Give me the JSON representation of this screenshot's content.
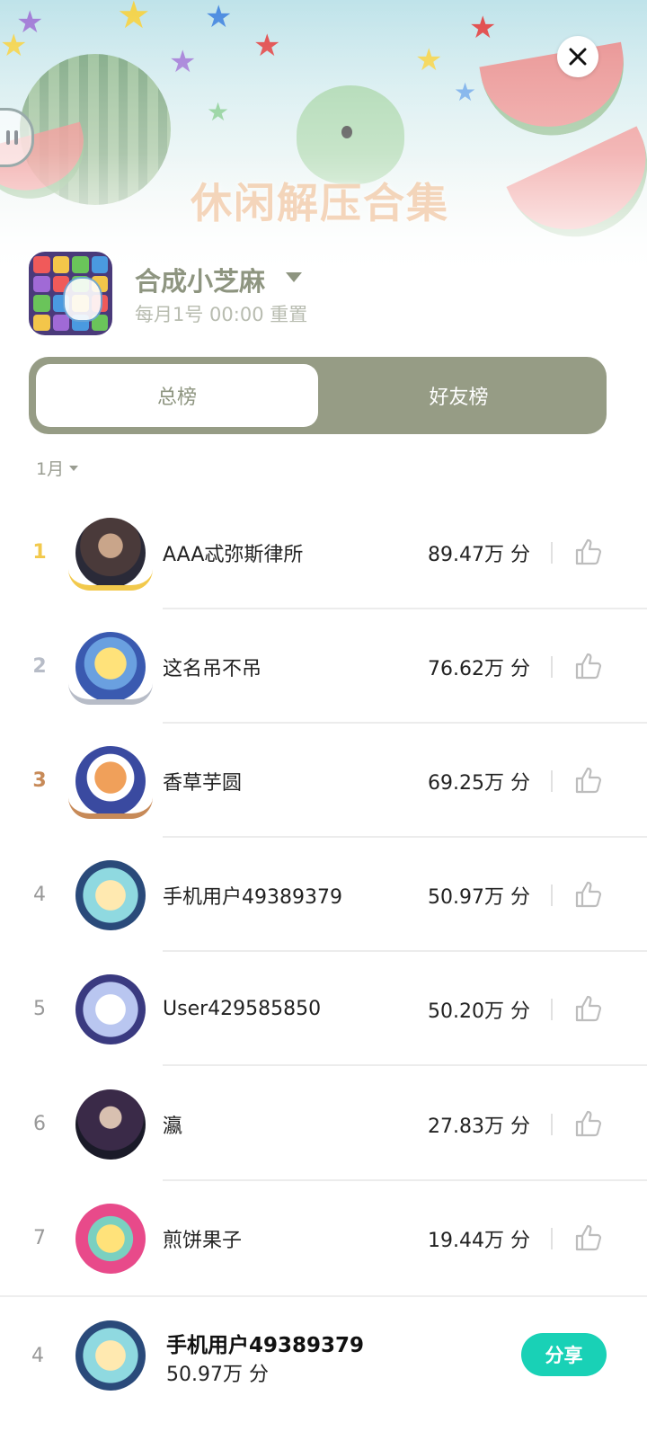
{
  "banner": {
    "title": "休闲解压合集"
  },
  "game": {
    "title": "合成小芝麻",
    "reset_text": "每月1号 00:00 重置"
  },
  "tabs": [
    {
      "label": "总榜",
      "active": true
    },
    {
      "label": "好友榜",
      "active": false
    }
  ],
  "month_filter": "1月",
  "colors": {
    "accent": "#969c85",
    "share": "#19d1b6",
    "rank1": "#f2c94c",
    "rank2": "#b7bcc7",
    "rank3": "#c78a58"
  },
  "leaderboard": [
    {
      "rank": "1",
      "name": "AAA忒弥斯律所",
      "score": "89.47万 分"
    },
    {
      "rank": "2",
      "name": "这名吊不吊",
      "score": "76.62万 分"
    },
    {
      "rank": "3",
      "name": "香草芋圆",
      "score": "69.25万 分"
    },
    {
      "rank": "4",
      "name": "手机用户49389379",
      "score": "50.97万 分"
    },
    {
      "rank": "5",
      "name": "User429585850",
      "score": "50.20万 分"
    },
    {
      "rank": "6",
      "name": "瀛",
      "score": "27.83万 分"
    },
    {
      "rank": "7",
      "name": "煎饼果子",
      "score": "19.44万 分"
    }
  ],
  "me": {
    "rank": "4",
    "name": "手机用户49389379",
    "score": "50.97万 分",
    "share_label": "分享"
  }
}
